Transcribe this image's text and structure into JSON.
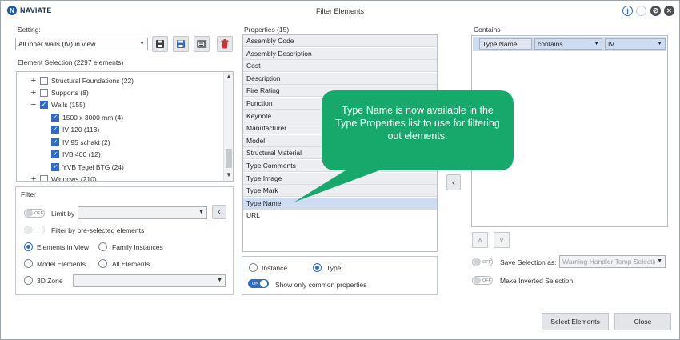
{
  "titlebar": {
    "logo_text": "NAVIATE",
    "title": "Filter Elements",
    "icons": [
      "info-icon",
      "minimize-icon",
      "help-icon",
      "close-icon"
    ]
  },
  "setting": {
    "label": "Setting:",
    "value": "All inner walls (IV) in view",
    "buttons": [
      "save-icon",
      "save-as-icon",
      "rename-icon",
      "delete-icon"
    ]
  },
  "element_selection": {
    "label": "Element Selection (2297 elements)",
    "items": [
      {
        "label": "Structural Foundations (22)",
        "checked": false,
        "expander": "+"
      },
      {
        "label": "Supports (8)",
        "checked": false,
        "expander": "+"
      },
      {
        "label": "Walls (155)",
        "checked": true,
        "expander": "−"
      },
      {
        "label": "1500 x 3000 mm (4)",
        "checked": true,
        "expander": ""
      },
      {
        "label": "IV 120 (113)",
        "checked": true,
        "expander": ""
      },
      {
        "label": "IV 95 schakt (2)",
        "checked": true,
        "expander": ""
      },
      {
        "label": "IVB 400 (12)",
        "checked": true,
        "expander": ""
      },
      {
        "label": "YVB Tegel BTG (24)",
        "checked": true,
        "expander": ""
      },
      {
        "label": "Windows (210)",
        "checked": false,
        "expander": "+"
      }
    ]
  },
  "filter": {
    "label": "Filter",
    "limit_by_label": "Limit by",
    "limit_by_value": "",
    "toggle_off": "OFF",
    "preselected_label": "Filter by pre-selected elements",
    "elements_in_view": "Elements in View",
    "family_instances": "Family Instances",
    "model_elements": "Model Elements",
    "all_elements": "All Elements",
    "zone_3d": "3D Zone",
    "selected_scope": "Elements in View"
  },
  "properties": {
    "label": "Properties (15)",
    "items": [
      "Assembly Code",
      "Assembly Description",
      "Cost",
      "Description",
      "Fire Rating",
      "Function",
      "Keynote",
      "Manufacturer",
      "Model",
      "Structural Material",
      "Type Comments",
      "Type Image",
      "Type Mark",
      "Type Name",
      "URL"
    ],
    "selected": "Type Name",
    "instance_label": "Instance",
    "type_label": "Type",
    "selected_kind": "Type",
    "toggle_on": "ON",
    "common_label": "Show only common properties"
  },
  "contains": {
    "label": "Contains",
    "row": {
      "property": "Type Name",
      "operator": "contains",
      "value": "IV"
    },
    "toggle_off": "OFF",
    "save_selection_label": "Save Selection as:",
    "save_selection_value": "Warning Handler Temp Selection",
    "inverted_label": "Make Inverted Selection"
  },
  "buttons": {
    "select": "Select Elements",
    "close": "Close"
  },
  "callout": {
    "text": "Type Name is now available in the Type Properties list to use for filtering out elements."
  },
  "colors": {
    "accent": "#2e6cc7",
    "callout": "#17a86b",
    "selection": "#cddcf2",
    "delete": "#d0312d"
  }
}
